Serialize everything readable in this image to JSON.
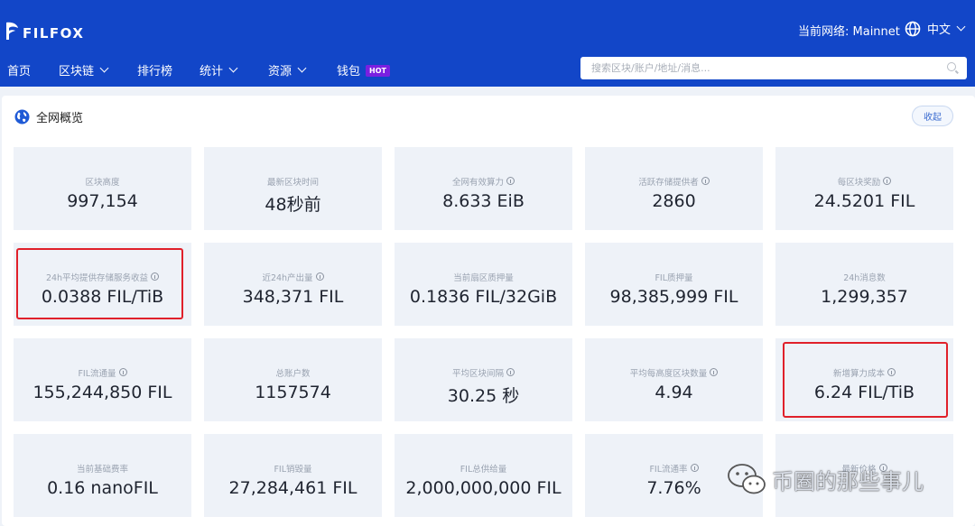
{
  "header": {
    "logo_text": "FILFOX",
    "network_label": "当前网络: Mainnet",
    "language": "中文"
  },
  "nav": [
    {
      "label": "首页",
      "dropdown": false
    },
    {
      "label": "区块链",
      "dropdown": true
    },
    {
      "label": "排行榜",
      "dropdown": false
    },
    {
      "label": "统计",
      "dropdown": true
    },
    {
      "label": "资源",
      "dropdown": true
    },
    {
      "label": "钱包",
      "dropdown": false,
      "badge": "HOT"
    }
  ],
  "search": {
    "placeholder": "搜索区块/账户/地址/消息..."
  },
  "panel": {
    "title": "全网概览",
    "collapse_label": "收起"
  },
  "stats": [
    {
      "label": "区块高度",
      "value": "997,154",
      "info": false
    },
    {
      "label": "最新区块时间",
      "value": "48秒前",
      "info": false
    },
    {
      "label": "全网有效算力",
      "value": "8.633 EiB",
      "info": true
    },
    {
      "label": "活跃存储提供者",
      "value": "2860",
      "info": true
    },
    {
      "label": "每区块奖励",
      "value": "24.5201 FIL",
      "info": true
    },
    {
      "label": "24h平均提供存储服务收益",
      "value": "0.0388 FIL/TiB",
      "info": true
    },
    {
      "label": "近24h产出量",
      "value": "348,371 FIL",
      "info": true
    },
    {
      "label": "当前扇区质押量",
      "value": "0.1836 FIL/32GiB",
      "info": false
    },
    {
      "label": "FIL质押量",
      "value": "98,385,999 FIL",
      "info": false
    },
    {
      "label": "24h消息数",
      "value": "1,299,357",
      "info": false
    },
    {
      "label": "FIL流通量",
      "value": "155,244,850 FIL",
      "info": true
    },
    {
      "label": "总账户数",
      "value": "1157574",
      "info": false
    },
    {
      "label": "平均区块间隔",
      "value": "30.25 秒",
      "info": true
    },
    {
      "label": "平均每高度区块数量",
      "value": "4.94",
      "info": true
    },
    {
      "label": "新增算力成本",
      "value": "6.24 FIL/TiB",
      "info": true
    },
    {
      "label": "当前基础费率",
      "value": "0.16 nanoFIL",
      "info": false
    },
    {
      "label": "FIL销毁量",
      "value": "27,284,461 FIL",
      "info": false
    },
    {
      "label": "FIL总供给量",
      "value": "2,000,000,000 FIL",
      "info": false
    },
    {
      "label": "FIL流通率",
      "value": "7.76%",
      "info": true
    },
    {
      "label": "最新价格",
      "value": "",
      "info": true
    }
  ],
  "watermark": {
    "text": "币圈的那些事儿"
  },
  "colors": {
    "header_bg": "#1246c8",
    "card_bg": "#eef2f8",
    "highlight": "#e0202a",
    "hot_badge": "#7a20e0"
  }
}
